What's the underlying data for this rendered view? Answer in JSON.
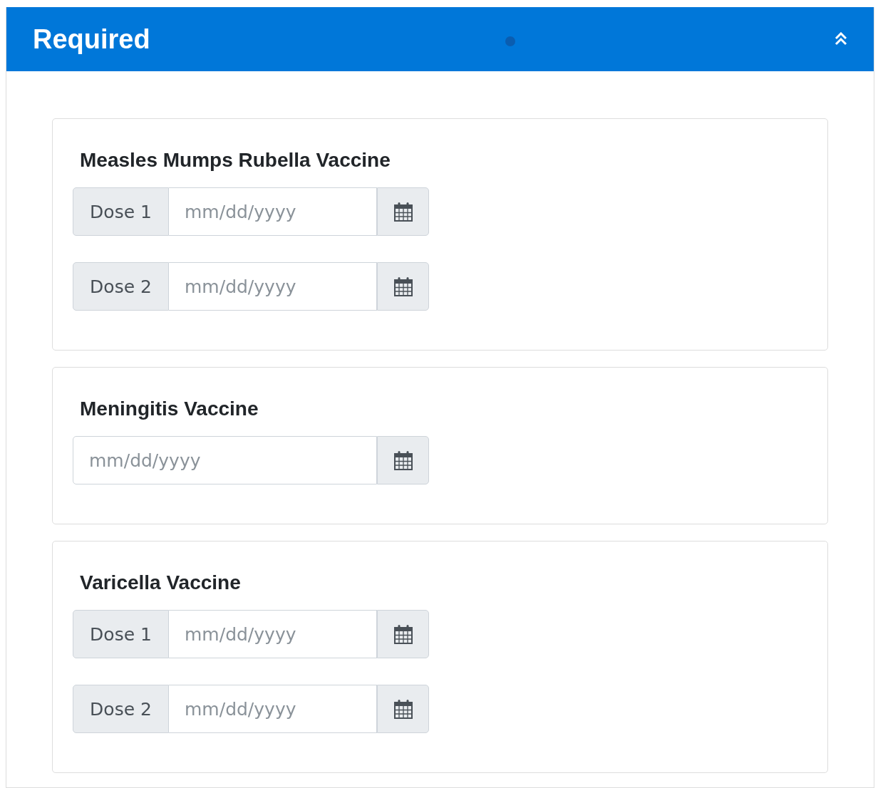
{
  "panel": {
    "title": "Required",
    "expanded": true
  },
  "vaccines": [
    {
      "name": "Measles Mumps Rubella Vaccine",
      "dates": [
        {
          "label": "Dose 1",
          "placeholder": "mm/dd/yyyy"
        },
        {
          "label": "Dose 2",
          "placeholder": "mm/dd/yyyy"
        }
      ]
    },
    {
      "name": "Meningitis Vaccine",
      "dates": [
        {
          "placeholder": "mm/dd/yyyy"
        }
      ]
    },
    {
      "name": "Varicella Vaccine",
      "dates": [
        {
          "label": "Dose 1",
          "placeholder": "mm/dd/yyyy"
        },
        {
          "label": "Dose 2",
          "placeholder": "mm/dd/yyyy"
        }
      ]
    }
  ]
}
